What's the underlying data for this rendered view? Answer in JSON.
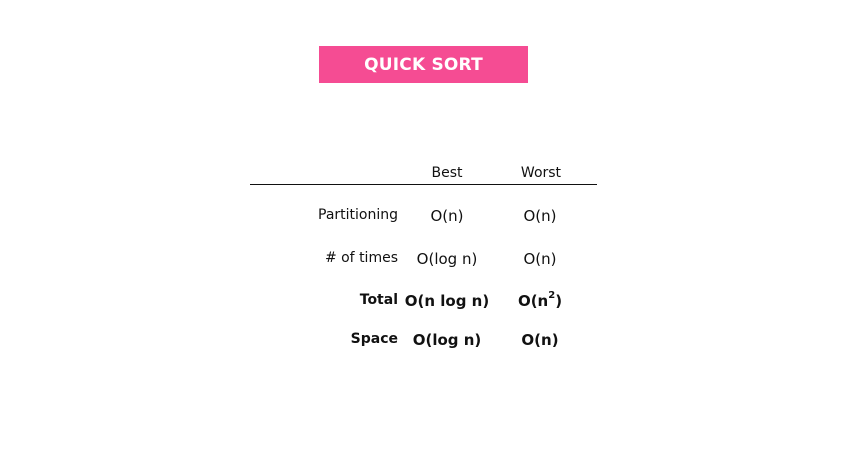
{
  "title": "QUICK SORT",
  "colors": {
    "banner": "#f54c93",
    "banner_text": "#ffffff",
    "text": "#111111"
  },
  "table": {
    "headers": {
      "best": "Best",
      "worst": "Worst"
    },
    "rows": [
      {
        "label": "Partitioning",
        "best": "O(n)",
        "worst": "O(n)"
      },
      {
        "label": "# of times",
        "best": "O(log n)",
        "worst": "O(n)"
      },
      {
        "label": "Total",
        "best": "O(n log n)",
        "worst_base": "O(n",
        "worst_exp": "2",
        "worst_close": ")"
      },
      {
        "label": "Space",
        "best": "O(log n)",
        "worst": "O(n)"
      }
    ]
  }
}
